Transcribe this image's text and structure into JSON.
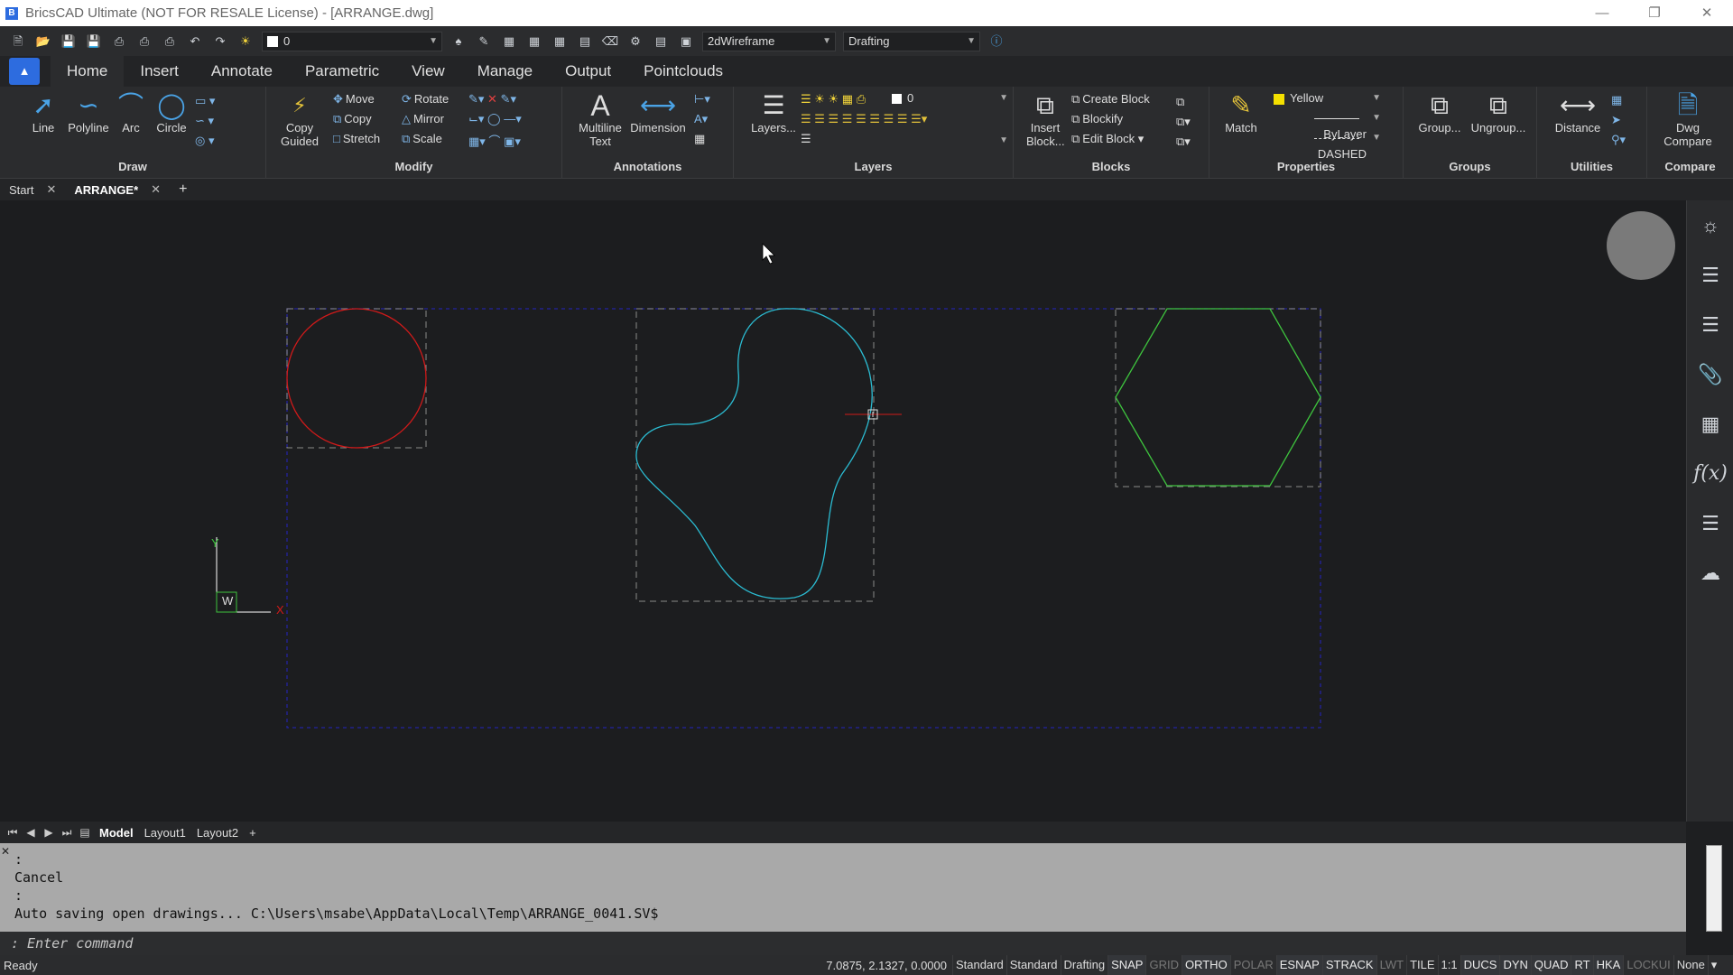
{
  "title": "BricsCAD Ultimate (NOT FOR RESALE License) - [ARRANGE.dwg]",
  "qat": {
    "layer_value": "0",
    "visual_style": "2dWireframe",
    "workspace": "Drafting"
  },
  "tabs": [
    "Home",
    "Insert",
    "Annotate",
    "Parametric",
    "View",
    "Manage",
    "Output",
    "Pointclouds"
  ],
  "ribbon": {
    "draw": {
      "label": "Draw",
      "line": "Line",
      "polyline": "Polyline",
      "arc": "Arc",
      "circle": "Circle"
    },
    "modify": {
      "label": "Modify",
      "copy_guided_1": "Copy",
      "copy_guided_2": "Guided",
      "move": "Move",
      "copy": "Copy",
      "stretch": "Stretch",
      "rotate": "Rotate",
      "mirror": "Mirror",
      "scale": "Scale"
    },
    "annotations": {
      "label": "Annotations",
      "mtext_1": "Multiline",
      "mtext_2": "Text",
      "dimension": "Dimension"
    },
    "layers": {
      "label": "Layers",
      "layers_btn": "Layers...",
      "current": "0"
    },
    "blocks": {
      "label": "Blocks",
      "insert_1": "Insert",
      "insert_2": "Block...",
      "create": "Create Block",
      "blockify": "Blockify",
      "edit": "Edit Block"
    },
    "properties": {
      "label": "Properties",
      "match": "Match",
      "color": "Yellow",
      "lineweight": "ByLayer",
      "linetype": "DASHED"
    },
    "groups": {
      "label": "Groups",
      "group": "Group...",
      "ungroup": "Ungroup..."
    },
    "utilities": {
      "label": "Utilities",
      "distance": "Distance"
    },
    "compare": {
      "label": "Compare",
      "dwg_1": "Dwg",
      "dwg_2": "Compare"
    }
  },
  "doc_tabs": {
    "start": "Start",
    "active": "ARRANGE*"
  },
  "ucs": {
    "x": "X",
    "y": "Y",
    "w": "W"
  },
  "layout_tabs": [
    "Model",
    "Layout1",
    "Layout2"
  ],
  "command_history": [
    ":",
    "Cancel",
    ":",
    "Auto saving open drawings... C:\\Users\\msabe\\AppData\\Local\\Temp\\ARRANGE_0041.SV$"
  ],
  "command_prompt": ": Enter command",
  "status": {
    "ready": "Ready",
    "coords": "7.0875, 2.1327, 0.0000",
    "items": [
      "Standard",
      "Standard",
      "Drafting",
      "SNAP",
      "GRID",
      "ORTHO",
      "POLAR",
      "ESNAP",
      "STRACK",
      "LWT",
      "TILE",
      "1:1",
      "DUCS",
      "DYN",
      "QUAD",
      "RT",
      "HKA",
      "LOCKUI",
      "None"
    ]
  },
  "colors": {
    "circle": "#d01a1a",
    "spline": "#2bbcd2",
    "hexagon": "#3ec43e",
    "boundary": "#2323a0",
    "yellow": "#f4e000"
  }
}
